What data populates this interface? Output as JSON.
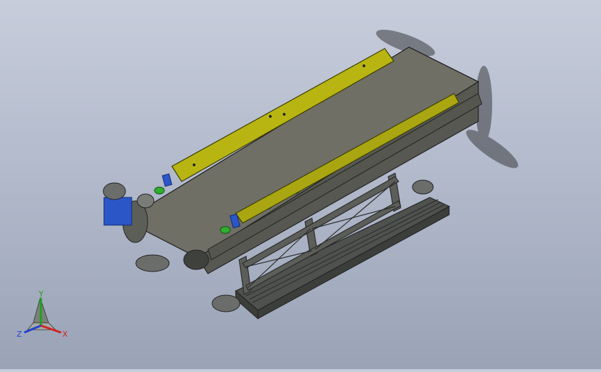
{
  "viewport": {
    "background_top": "#c7cddb",
    "background_bottom": "#9aa3b6"
  },
  "model": {
    "belt_color": "#6f6f66",
    "frame_color": "#5c5e5a",
    "guard_color": "#b8b512",
    "roller_color": "#2fae2f",
    "motor_color": "#2a56c8",
    "walkway_color": "#4f514e"
  },
  "triad": {
    "x_label": "X",
    "y_label": "Y",
    "z_label": "Z",
    "x_color": "#d42020",
    "y_color": "#1aa51a",
    "z_color": "#2040d0"
  }
}
